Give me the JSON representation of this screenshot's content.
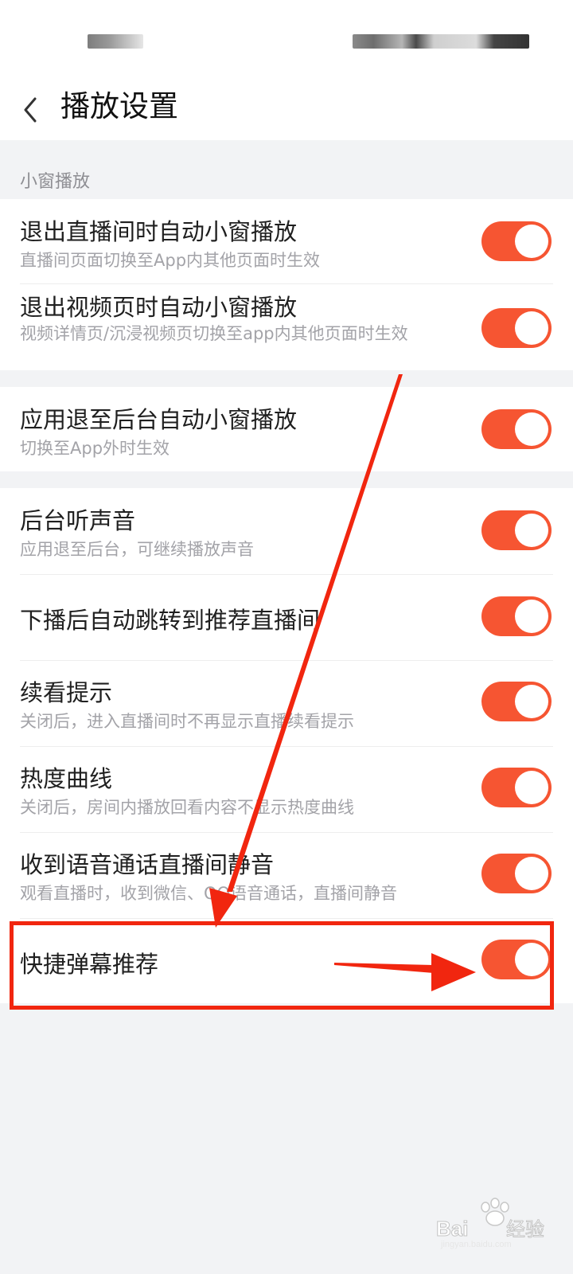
{
  "colors": {
    "toggle_on": "#f65532",
    "annotation": "#f1260f",
    "background": "#f2f3f5"
  },
  "header": {
    "back_icon": "chevron-left-icon",
    "title": "播放设置"
  },
  "section": {
    "label": "小窗播放"
  },
  "settings": [
    {
      "title": "退出直播间时自动小窗播放",
      "subtitle": "直播间页面切换至App内其他页面时生效",
      "enabled": true
    },
    {
      "title": "退出视频页时自动小窗播放",
      "subtitle": "视频详情页/沉浸视频页切换至app内其他页面时生效",
      "enabled": true
    },
    {
      "title": "应用退至后台自动小窗播放",
      "subtitle": "切换至App外时生效",
      "enabled": true
    },
    {
      "title": "后台听声音",
      "subtitle": "应用退至后台，可继续播放声音",
      "enabled": true
    },
    {
      "title": "下播后自动跳转到推荐直播间",
      "subtitle": "",
      "enabled": true
    },
    {
      "title": "续看提示",
      "subtitle": "关闭后，进入直播间时不再显示直播续看提示",
      "enabled": true
    },
    {
      "title": "热度曲线",
      "subtitle": "关闭后，房间内播放回看内容不显示热度曲线",
      "enabled": true
    },
    {
      "title": "收到语音通话直播间静音",
      "subtitle": "观看直播时，收到微信、QQ语音通话，直播间静音",
      "enabled": true
    },
    {
      "title": "快捷弹幕推荐",
      "subtitle": "",
      "enabled": true
    }
  ],
  "watermark": {
    "text": "Baidu经验",
    "subtext": "jingyan.baidu.com"
  }
}
